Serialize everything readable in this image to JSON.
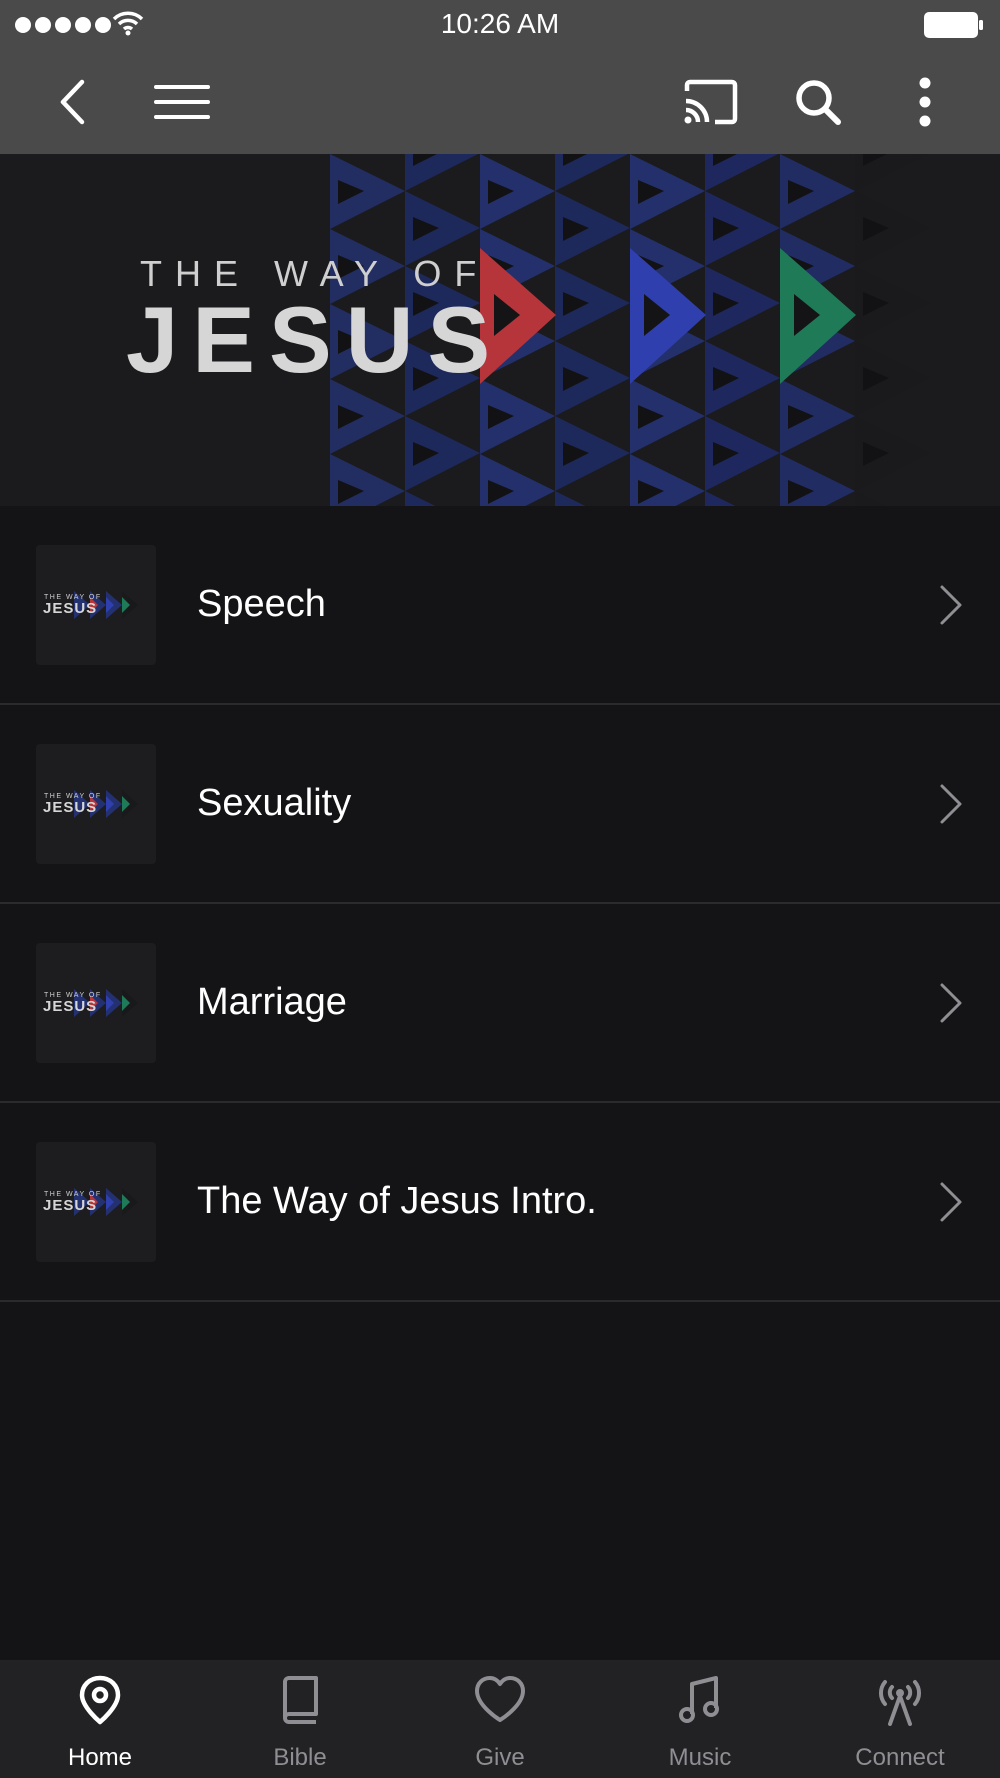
{
  "status_bar": {
    "time": "10:26 AM"
  },
  "toolbar": {
    "icons": [
      "back-icon",
      "menu-icon",
      "cast-icon",
      "search-icon",
      "more-vertical-icon"
    ]
  },
  "hero": {
    "line1": "THE WAY OF",
    "line2": "JESUS",
    "colors": {
      "red": "#b5353a",
      "blue": "#2f3fae",
      "green": "#1f7a58",
      "dark_blue": "#1e2a6a"
    }
  },
  "list": {
    "thumb_line1": "THE WAY OF",
    "thumb_line2": "JESUS",
    "items": [
      {
        "title": "Speech"
      },
      {
        "title": "Sexuality"
      },
      {
        "title": "Marriage"
      },
      {
        "title": "The Way of Jesus Intro."
      }
    ]
  },
  "tabbar": {
    "tabs": [
      {
        "label": "Home",
        "icon": "location-pin-icon",
        "active": true
      },
      {
        "label": "Bible",
        "icon": "book-icon",
        "active": false
      },
      {
        "label": "Give",
        "icon": "heart-icon",
        "active": false
      },
      {
        "label": "Music",
        "icon": "music-note-icon",
        "active": false
      },
      {
        "label": "Connect",
        "icon": "broadcast-icon",
        "active": false
      }
    ]
  }
}
